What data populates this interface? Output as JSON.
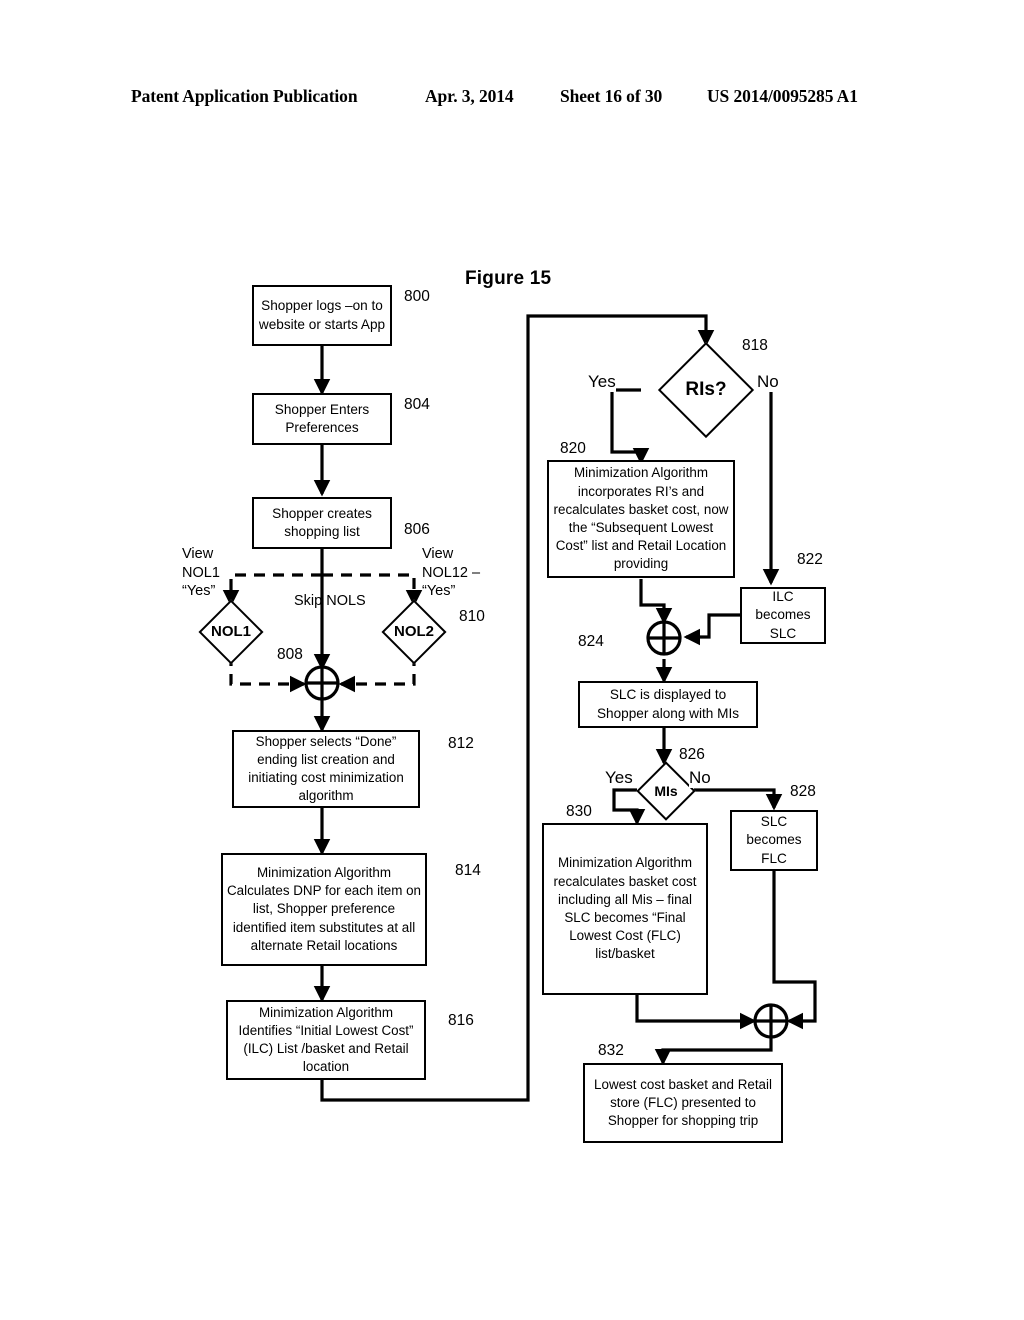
{
  "header": {
    "publication": "Patent Application Publication",
    "date": "Apr. 3, 2014",
    "sheet": "Sheet 16 of 30",
    "patent_number": "US 2014/0095285 A1"
  },
  "figure": {
    "title": "Figure 15"
  },
  "nodes": {
    "n800": {
      "ref": "800",
      "text": "Shopper logs –on to website or starts App"
    },
    "n804": {
      "ref": "804",
      "text": "Shopper Enters Preferences"
    },
    "n806": {
      "ref": "806",
      "text": "Shopper creates shopping list"
    },
    "n808": {
      "ref": "808",
      "label": "NOL1"
    },
    "n810": {
      "ref": "810",
      "label": "NOL2"
    },
    "n812": {
      "ref": "812",
      "text": "Shopper selects “Done” ending list creation and initiating  cost minimization algorithm"
    },
    "n814": {
      "ref": "814",
      "text": "Minimization Algorithm Calculates DNP for each item on list, Shopper preference identified  item substitutes at all alternate Retail locations"
    },
    "n816": {
      "ref": "816",
      "text": "Minimization Algorithm Identifies “Initial Lowest Cost” (ILC) List /basket and Retail location"
    },
    "n818": {
      "ref": "818",
      "label": "RIs?"
    },
    "n820": {
      "ref": "820",
      "text": "Minimization Algorithm incorporates RI’s and recalculates basket cost, now the “Subsequent Lowest Cost” list and Retail Location providing"
    },
    "n822": {
      "ref": "822",
      "text": "ILC becomes SLC"
    },
    "n824": {
      "ref": "824"
    },
    "n826": {
      "ref": "826",
      "label": "MIs"
    },
    "n828": {
      "ref": "828",
      "text": "SLC becomes FLC"
    },
    "n830": {
      "ref": "830",
      "text": "Minimization Algorithm recalculates basket cost including all Mis – final SLC becomes “Final Lowest Cost (FLC) list/basket"
    },
    "n832": {
      "ref": "832",
      "text": "Lowest cost basket and Retail store (FLC) presented to Shopper for shopping trip"
    }
  },
  "edge_labels": {
    "view_nol1": "View\nNOL1\n“Yes”",
    "view_nol1_l1": "View",
    "view_nol1_l2": "NOL1",
    "view_nol1_l3": "“Yes”",
    "view_nol12_l1": "View",
    "view_nol12_l2": "NOL12 –",
    "view_nol12_l3": "“Yes”",
    "skip_nols": "Skip NOLS",
    "ris_yes": "Yes",
    "ris_no": "No",
    "mis_yes": "Yes",
    "mis_no": "No"
  },
  "colors": {
    "stroke": "#000000",
    "background": "#ffffff"
  }
}
